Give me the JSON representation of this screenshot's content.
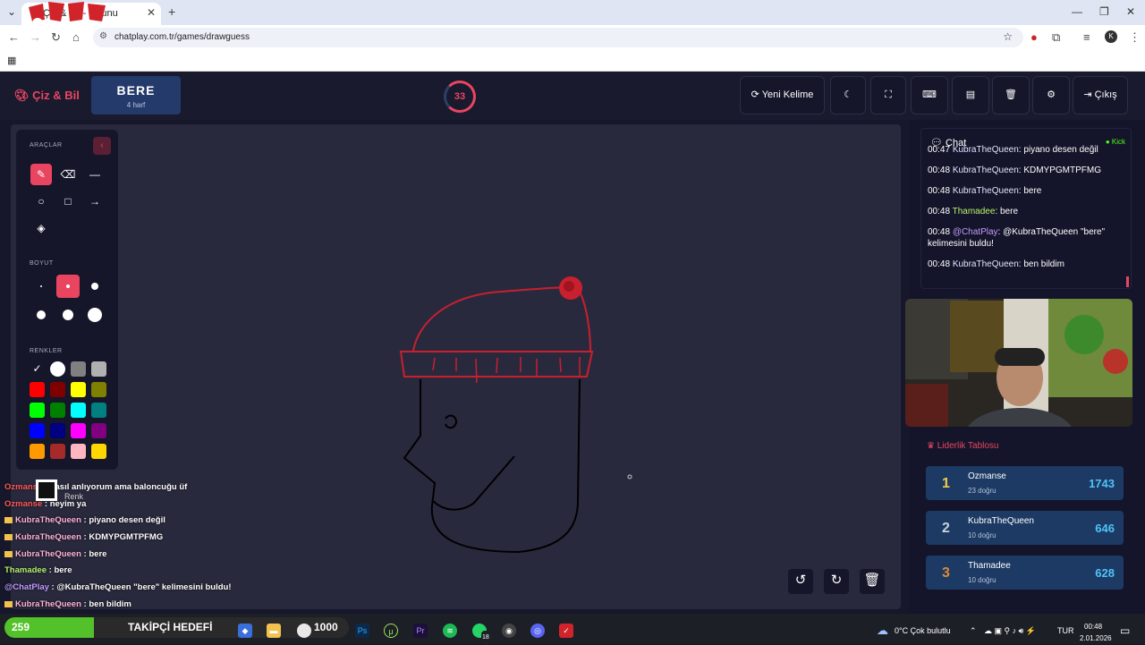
{
  "browser": {
    "tab_title": "Çiz & Bil - Oyunu",
    "url": "chatplay.com.tr/games/drawguess",
    "profile_initial": "K",
    "extension_badge": "1"
  },
  "app": {
    "logo": "Çiz & Bil",
    "word": "BERE",
    "word_hint": "4 harf",
    "timer": "33",
    "buttons": {
      "new_word": "Yeni Kelime",
      "exit": "Çıkış"
    }
  },
  "tools": {
    "section_tools": "ARAÇLAR",
    "section_size": "BOYUT",
    "section_colors": "RENKLER",
    "custom_color": "Renk",
    "colors": [
      "#ffffff",
      "#ffffff",
      "#808080",
      "#b0b0b0",
      "#ff0000",
      "#800000",
      "#ffff00",
      "#808000",
      "#00ff00",
      "#008000",
      "#00ffff",
      "#008080",
      "#0000ff",
      "#000080",
      "#ff00ff",
      "#800080",
      "#ff9900",
      "#a52a2a",
      "#ffb6c1",
      "#ffd700"
    ],
    "accent": "#e94560"
  },
  "chat": {
    "title": "Chat",
    "platform": "Kick",
    "messages": [
      {
        "time": "00:47",
        "user": "KubraTheQueen",
        "text": "piyano desen değil",
        "color": "#dfe4ff"
      },
      {
        "time": "00:48",
        "user": "KubraTheQueen",
        "text": "KDMYPGMTPFMG",
        "color": "#dfe4ff"
      },
      {
        "time": "00:48",
        "user": "KubraTheQueen",
        "text": "bere",
        "color": "#dfe4ff"
      },
      {
        "time": "00:48",
        "user": "Thamadee",
        "text": "bere",
        "color": "#b6f26b"
      },
      {
        "time": "00:48",
        "user": "@ChatPlay",
        "text": "@KubraTheQueen \"bere\" kelimesini buldu!",
        "color": "#c39cff"
      },
      {
        "time": "00:48",
        "user": "KubraTheQueen",
        "text": "ben bildim",
        "color": "#dfe4ff"
      }
    ]
  },
  "leaderboard": {
    "title": "Liderlik Tablosu",
    "rows": [
      {
        "rank": "1",
        "name": "Ozmanse",
        "sub": "23 doğru",
        "score": "1743",
        "rank_color": "#f2c94c"
      },
      {
        "rank": "2",
        "name": "KubraTheQueen",
        "sub": "10 doğru",
        "score": "646",
        "rank_color": "#c8d0dc"
      },
      {
        "rank": "3",
        "name": "Thamadee",
        "sub": "10 doğru",
        "score": "628",
        "rank_color": "#d98b3a"
      }
    ]
  },
  "overlay_chat": [
    {
      "user": "Ozmanse",
      "text": "nasıl anlıyorum ama baloncuğu üf",
      "color": "#ff5a5a",
      "crown": false
    },
    {
      "user": "Ozmanse",
      "text": "neyim ya",
      "color": "#ff5a5a",
      "crown": false
    },
    {
      "user": "KubraTheQueen",
      "text": "piyano desen değil",
      "color": "#ffb3d9",
      "crown": true
    },
    {
      "user": "KubraTheQueen",
      "text": "KDMYPGMTPFMG",
      "color": "#ffb3d9",
      "crown": true
    },
    {
      "user": "KubraTheQueen",
      "text": "bere",
      "color": "#ffb3d9",
      "crown": true
    },
    {
      "user": "Thamadee",
      "text": "bere",
      "color": "#b6f26b",
      "crown": false
    },
    {
      "user": "@ChatPlay",
      "text": "@KubraTheQueen \"bere\" kelimesini buldu!",
      "color": "#c39cff",
      "crown": false
    },
    {
      "user": "KubraTheQueen",
      "text": "ben bildim",
      "color": "#ffb3d9",
      "crown": true
    }
  ],
  "follower_goal": {
    "current": "259",
    "label": "TAKİPÇİ HEDEFİ",
    "target": "1000",
    "progress": 0.259
  },
  "taskbar": {
    "weather": "0°C  Çok bulutlu",
    "lang": "TUR",
    "time": "00:48",
    "date": "2.01.2026",
    "whatsapp_badge": "18"
  }
}
